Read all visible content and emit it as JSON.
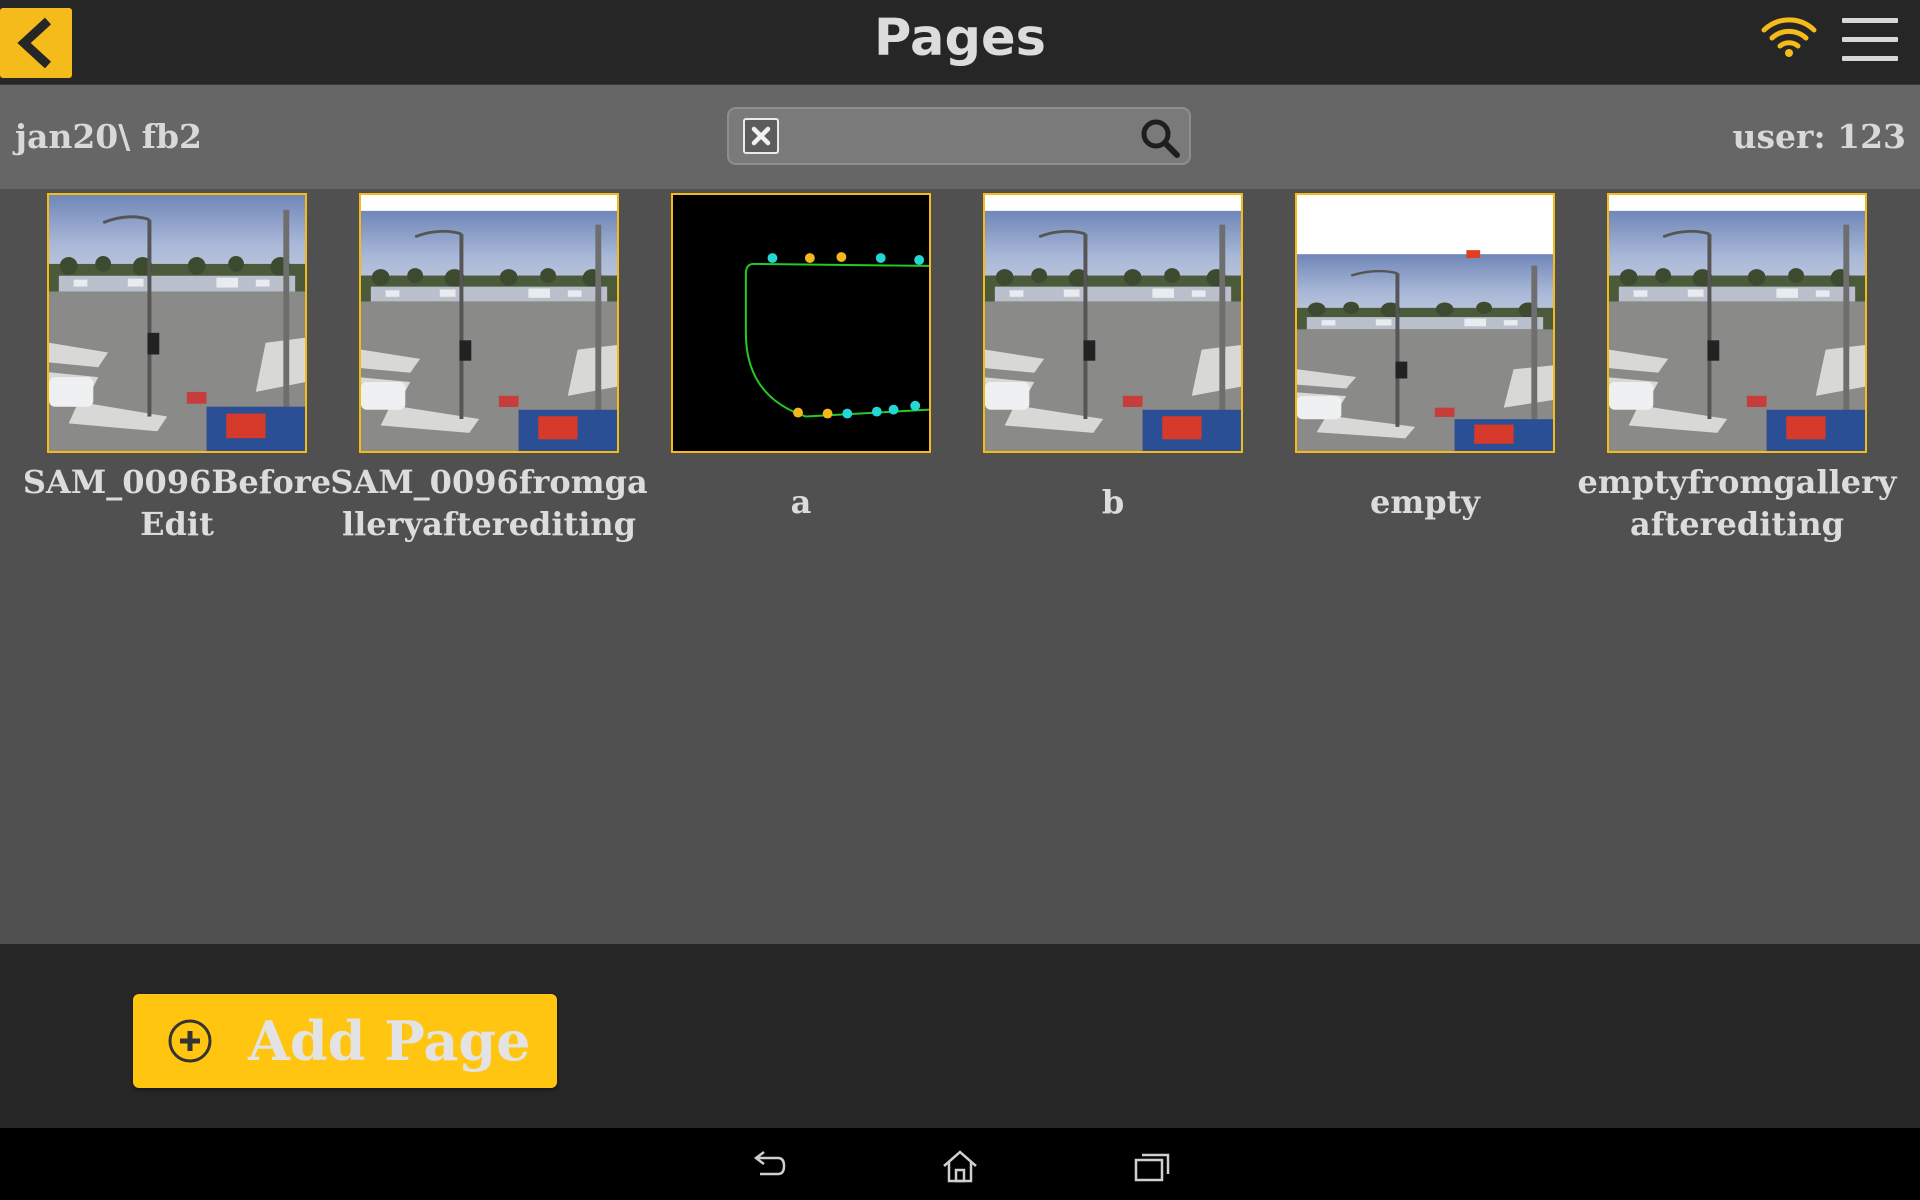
{
  "header": {
    "title": "Pages",
    "back_icon": "chevron-left-icon",
    "wifi_icon": "wifi-icon",
    "menu_icon": "hamburger-menu-icon",
    "accent_color": "#F5BB1A"
  },
  "subheader": {
    "path": "jan20\\ fb2",
    "user": "user: 123",
    "search": {
      "value": "",
      "placeholder": "",
      "clear_icon": "clear-icon",
      "search_icon": "search-icon"
    }
  },
  "pages": [
    {
      "label": "SAM_0096BeforeEdit",
      "thumbnail": "intersection-photo"
    },
    {
      "label": "SAM_0096fromgalleryafterediting",
      "thumbnail": "intersection-photo"
    },
    {
      "label": "a",
      "thumbnail": "black-canvas-with-markers"
    },
    {
      "label": "b",
      "thumbnail": "intersection-photo"
    },
    {
      "label": "empty",
      "thumbnail": "intersection-photo-offset"
    },
    {
      "label": "emptyfromgalleryafterediting",
      "thumbnail": "intersection-photo"
    }
  ],
  "footer": {
    "add_button_label": "Add Page",
    "add_icon": "plus-circle-icon",
    "button_color": "#FFC510"
  },
  "system_nav": {
    "icons": [
      "back-nav-icon",
      "home-nav-icon",
      "recent-apps-icon"
    ]
  }
}
